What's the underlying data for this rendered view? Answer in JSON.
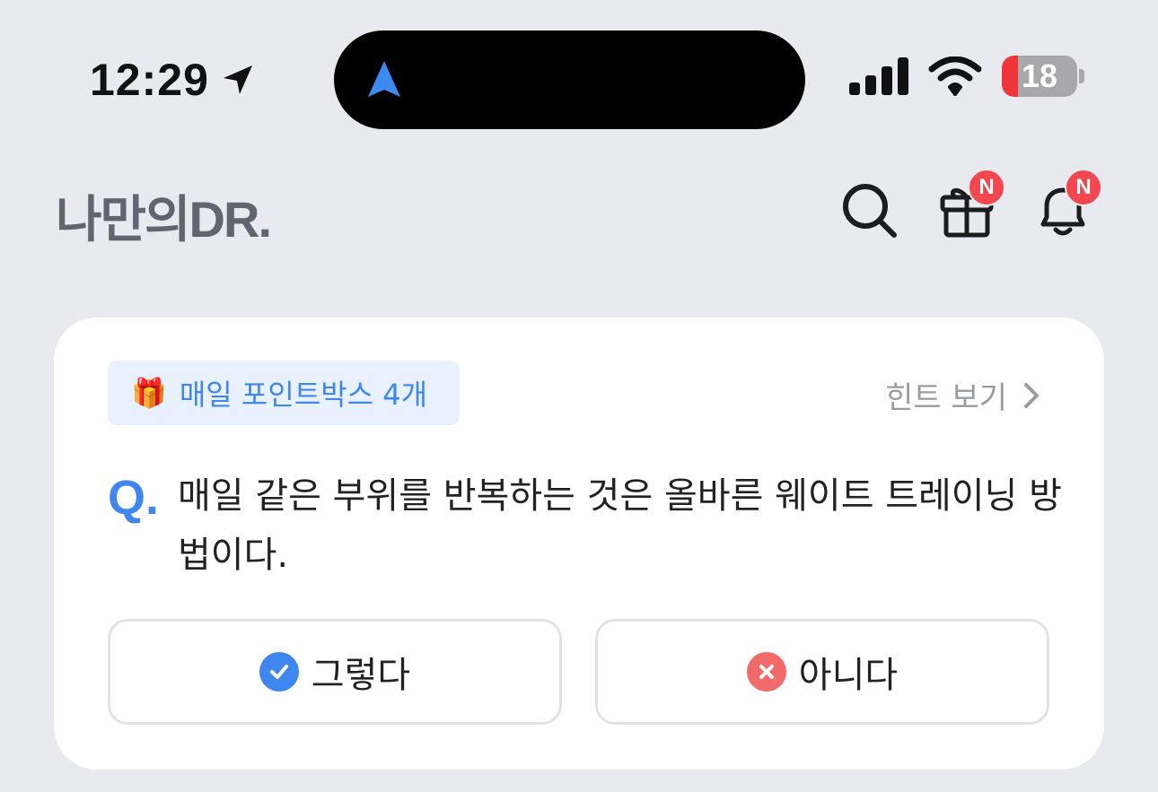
{
  "status_bar": {
    "time": "12:29",
    "battery": "18",
    "icons": [
      "location-arrow-icon",
      "signal-icon",
      "wifi-icon",
      "battery-icon"
    ]
  },
  "header": {
    "logo": "나만의DR.",
    "icons": [
      "search-icon",
      "gift-icon",
      "bell-icon"
    ],
    "badge_gift": "N",
    "badge_bell": "N"
  },
  "quiz": {
    "pill_emoji": "🎁",
    "pill_label": "매일 포인트박스 4개",
    "hint_label": "힌트 보기",
    "q_mark": "Q.",
    "question": "매일 같은 부위를 반복하는 것은 올바른 웨이트 트레이닝 방법이다.",
    "yes_label": "그렇다",
    "no_label": "아니다"
  },
  "colors": {
    "accent": "#3f86ee",
    "badge": "#f2474f",
    "no_icon": "#f26a6a",
    "background": "#e9eaef"
  }
}
